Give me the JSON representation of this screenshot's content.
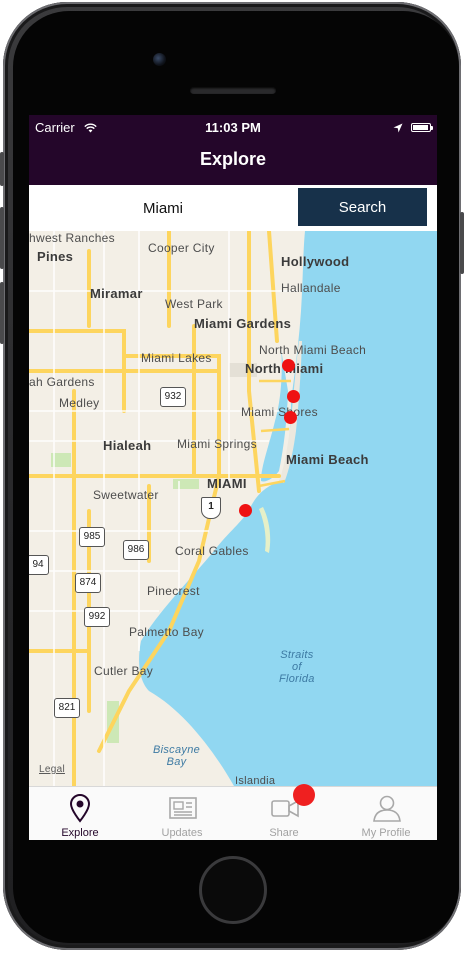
{
  "status_bar": {
    "carrier": "Carrier",
    "time": "11:03 PM",
    "battery_level": 0.95
  },
  "nav": {
    "title": "Explore"
  },
  "search": {
    "value": "Miami",
    "button_label": "Search"
  },
  "map": {
    "labels": {
      "west_ranches": "hwest Ranches",
      "cooper_city": "Cooper City",
      "pines": "Pines",
      "hollywood": "Hollywood",
      "hallandale": "Hallandale",
      "miramar": "Miramar",
      "west_park": "West Park",
      "miami_gardens": "Miami Gardens",
      "north_miami_beach": "North Miami Beach",
      "miami_lakes": "Miami Lakes",
      "north_miami": "North Miami",
      "ah_gardens": "ah Gardens",
      "medley": "Medley",
      "miami_shores": "Miami Shores",
      "hialeah": "Hialeah",
      "miami_springs": "Miami Springs",
      "miami_beach": "Miami Beach",
      "miami": "MIAMI",
      "sweetwater": "Sweetwater",
      "coral_gables": "Coral Gables",
      "pinecrest": "Pinecrest",
      "palmetto_bay": "Palmetto Bay",
      "cutler_bay": "Cutler Bay",
      "straits": "Straits\nof\nFlorida",
      "biscayne_bay": "Biscayne\nBay",
      "islandia": "Islandia",
      "legal": "Legal"
    },
    "shields": [
      "932",
      "1",
      "985",
      "986",
      "874",
      "992",
      "821",
      "94"
    ],
    "pins": [
      "pin-1",
      "pin-2",
      "pin-3",
      "pin-4"
    ]
  },
  "tabs": [
    {
      "label": "Explore",
      "icon": "map-pin-icon",
      "active": true
    },
    {
      "label": "Updates",
      "icon": "newspaper-icon",
      "active": false
    },
    {
      "label": "Share",
      "icon": "video-camera-icon",
      "active": false
    },
    {
      "label": "My Profile",
      "icon": "person-icon",
      "active": false
    }
  ],
  "colors": {
    "nav_bg": "#24062a",
    "search_button": "#17314a",
    "pin": "#ef1212",
    "water": "#91d7f1",
    "land": "#f3efe6",
    "road": "#fdd55e"
  }
}
